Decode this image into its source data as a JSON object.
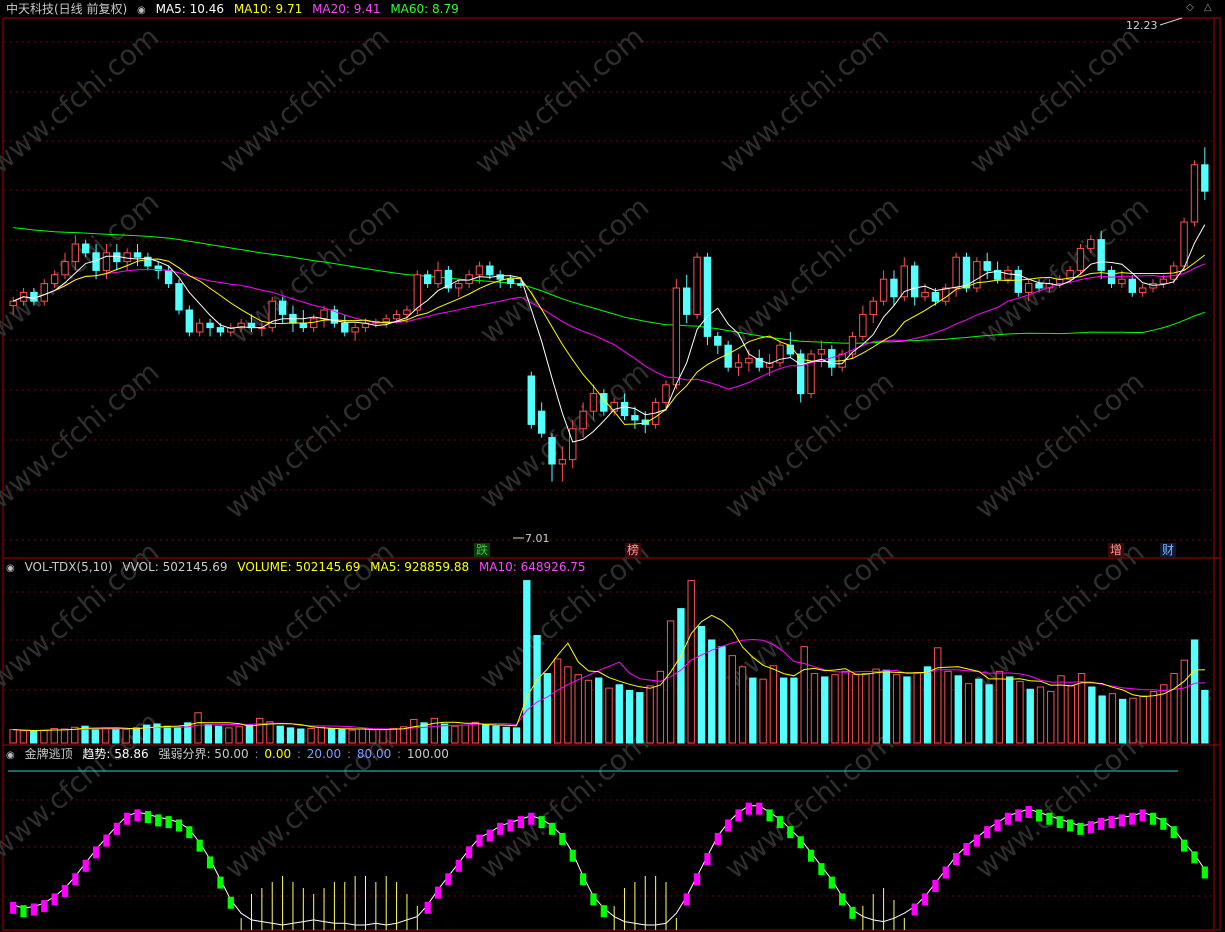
{
  "main_header": {
    "title": "中天科技(日线 前复权)",
    "ma5": "MA5: 10.46",
    "ma10": "MA10: 9.71",
    "ma20": "MA20: 9.41",
    "ma60": "MA60: 8.79"
  },
  "vol_header": {
    "name": "VOL-TDX(5,10)",
    "vvol": "VVOL: 502145.69",
    "volume": "VOLUME: 502145.69",
    "ma5": "MA5: 928859.88",
    "ma10": "MA10: 648926.75"
  },
  "ind_header": {
    "name": "金牌逃顶",
    "trend": "趋势: 58.86",
    "label": "强弱分界: 50.00",
    "v0": "0.00",
    "v20": "20.00",
    "v80": "80.00",
    "v100": "100.00"
  },
  "annotations": {
    "high_label": "12.23",
    "low_label": "7.01"
  },
  "event_tags": [
    {
      "text": "跌",
      "color": "#3cc43c"
    },
    {
      "text": "榜",
      "color": "#ff9999"
    },
    {
      "text": "增",
      "color": "#ff9999"
    },
    {
      "text": "财",
      "color": "#7fb3ff"
    }
  ],
  "watermark": "www.cfchi.com",
  "colors": {
    "up": "#ff5050",
    "down": "#54ffff",
    "ma5": "#ffffff",
    "ma10": "#ffff00",
    "ma20": "#ff00ff",
    "ma60": "#00ff00",
    "frame": "#b00000",
    "grid": "#800000",
    "ind_up": "#ff00ff",
    "ind_down": "#00ff00"
  },
  "chart_data": [
    {
      "type": "candlestick",
      "title": "中天科技(日线 前复权)",
      "ylim": [
        6.5,
        12.5
      ],
      "ohlc": [
        [
          9.3,
          9.4,
          9.2,
          9.35
        ],
        [
          9.35,
          9.5,
          9.3,
          9.45
        ],
        [
          9.45,
          9.5,
          9.3,
          9.35
        ],
        [
          9.35,
          9.6,
          9.3,
          9.55
        ],
        [
          9.55,
          9.7,
          9.5,
          9.65
        ],
        [
          9.65,
          9.9,
          9.6,
          9.8
        ],
        [
          9.8,
          10.1,
          9.7,
          10.0
        ],
        [
          10.0,
          10.05,
          9.85,
          9.9
        ],
        [
          9.9,
          10.0,
          9.6,
          9.7
        ],
        [
          9.7,
          10.0,
          9.6,
          9.9
        ],
        [
          9.9,
          10.0,
          9.7,
          9.8
        ],
        [
          9.8,
          9.95,
          9.7,
          9.9
        ],
        [
          9.9,
          10.0,
          9.75,
          9.85
        ],
        [
          9.85,
          9.9,
          9.7,
          9.75
        ],
        [
          9.75,
          9.8,
          9.6,
          9.7
        ],
        [
          9.7,
          9.75,
          9.5,
          9.55
        ],
        [
          9.55,
          9.6,
          9.2,
          9.25
        ],
        [
          9.25,
          9.3,
          8.95,
          9.0
        ],
        [
          9.0,
          9.15,
          8.95,
          9.1
        ],
        [
          9.1,
          9.15,
          8.95,
          9.05
        ],
        [
          9.05,
          9.1,
          8.95,
          9.0
        ],
        [
          9.0,
          9.1,
          8.95,
          9.05
        ],
        [
          9.05,
          9.15,
          9.0,
          9.1
        ],
        [
          9.1,
          9.2,
          9.0,
          9.05
        ],
        [
          9.05,
          9.1,
          8.95,
          9.05
        ],
        [
          9.05,
          9.4,
          9.0,
          9.35
        ],
        [
          9.35,
          9.4,
          9.1,
          9.2
        ],
        [
          9.2,
          9.3,
          9.0,
          9.1
        ],
        [
          9.1,
          9.25,
          9.0,
          9.05
        ],
        [
          9.05,
          9.2,
          9.0,
          9.15
        ],
        [
          9.15,
          9.3,
          9.05,
          9.25
        ],
        [
          9.25,
          9.3,
          9.05,
          9.1
        ],
        [
          9.1,
          9.2,
          8.95,
          9.0
        ],
        [
          9.0,
          9.1,
          8.9,
          9.05
        ],
        [
          9.05,
          9.15,
          9.0,
          9.1
        ],
        [
          9.1,
          9.15,
          9.05,
          9.12
        ],
        [
          9.12,
          9.2,
          9.05,
          9.15
        ],
        [
          9.15,
          9.25,
          9.1,
          9.2
        ],
        [
          9.2,
          9.3,
          9.1,
          9.25
        ],
        [
          9.25,
          9.7,
          9.2,
          9.65
        ],
        [
          9.65,
          9.7,
          9.5,
          9.55
        ],
        [
          9.55,
          9.8,
          9.5,
          9.7
        ],
        [
          9.7,
          9.75,
          9.45,
          9.5
        ],
        [
          9.5,
          9.6,
          9.4,
          9.55
        ],
        [
          9.55,
          9.7,
          9.5,
          9.65
        ],
        [
          9.65,
          9.8,
          9.55,
          9.75
        ],
        [
          9.75,
          9.8,
          9.6,
          9.65
        ],
        [
          9.65,
          9.7,
          9.5,
          9.6
        ],
        [
          9.6,
          9.65,
          9.5,
          9.55
        ],
        [
          9.55,
          9.6,
          9.5,
          9.53
        ],
        [
          8.5,
          8.55,
          7.9,
          7.95
        ],
        [
          8.1,
          8.2,
          7.8,
          7.85
        ],
        [
          7.8,
          7.85,
          7.3,
          7.5
        ],
        [
          7.5,
          7.7,
          7.3,
          7.55
        ],
        [
          7.55,
          8.0,
          7.45,
          7.9
        ],
        [
          7.9,
          8.2,
          7.8,
          8.1
        ],
        [
          8.1,
          8.4,
          8.0,
          8.3
        ],
        [
          8.3,
          8.35,
          8.05,
          8.1
        ],
        [
          8.1,
          8.25,
          8.05,
          8.2
        ],
        [
          8.2,
          8.3,
          8.0,
          8.05
        ],
        [
          8.05,
          8.15,
          7.9,
          8.0
        ],
        [
          8.0,
          8.1,
          7.85,
          7.95
        ],
        [
          7.95,
          8.25,
          7.9,
          8.2
        ],
        [
          8.2,
          8.45,
          8.1,
          8.4
        ],
        [
          8.4,
          9.6,
          8.35,
          9.5
        ],
        [
          9.5,
          9.65,
          9.1,
          9.2
        ],
        [
          9.2,
          9.9,
          9.15,
          9.85
        ],
        [
          9.85,
          9.9,
          8.85,
          8.95
        ],
        [
          8.95,
          9.0,
          8.75,
          8.85
        ],
        [
          8.85,
          8.9,
          8.55,
          8.6
        ],
        [
          8.6,
          8.75,
          8.5,
          8.65
        ],
        [
          8.65,
          8.8,
          8.55,
          8.7
        ],
        [
          8.7,
          8.8,
          8.55,
          8.6
        ],
        [
          8.6,
          8.75,
          8.5,
          8.65
        ],
        [
          8.65,
          8.9,
          8.6,
          8.85
        ],
        [
          8.85,
          9.0,
          8.7,
          8.75
        ],
        [
          8.75,
          8.8,
          8.2,
          8.3
        ],
        [
          8.3,
          8.8,
          8.25,
          8.75
        ],
        [
          8.75,
          8.9,
          8.6,
          8.8
        ],
        [
          8.8,
          8.85,
          8.5,
          8.6
        ],
        [
          8.6,
          8.8,
          8.55,
          8.75
        ],
        [
          8.75,
          9.0,
          8.7,
          8.95
        ],
        [
          8.95,
          9.3,
          8.9,
          9.2
        ],
        [
          9.2,
          9.4,
          9.1,
          9.35
        ],
        [
          9.35,
          9.7,
          9.3,
          9.6
        ],
        [
          9.6,
          9.7,
          9.3,
          9.4
        ],
        [
          9.4,
          9.85,
          9.35,
          9.75
        ],
        [
          9.75,
          9.8,
          9.3,
          9.4
        ],
        [
          9.4,
          9.55,
          9.35,
          9.45
        ],
        [
          9.45,
          9.5,
          9.3,
          9.35
        ],
        [
          9.35,
          9.55,
          9.3,
          9.5
        ],
        [
          9.5,
          9.9,
          9.4,
          9.85
        ],
        [
          9.85,
          9.9,
          9.45,
          9.5
        ],
        [
          9.5,
          9.85,
          9.45,
          9.8
        ],
        [
          9.8,
          9.9,
          9.6,
          9.7
        ],
        [
          9.7,
          9.8,
          9.55,
          9.6
        ],
        [
          9.6,
          9.75,
          9.55,
          9.7
        ],
        [
          9.7,
          9.75,
          9.4,
          9.45
        ],
        [
          9.45,
          9.6,
          9.35,
          9.55
        ],
        [
          9.55,
          9.6,
          9.45,
          9.5
        ],
        [
          9.5,
          9.6,
          9.45,
          9.55
        ],
        [
          9.55,
          9.65,
          9.5,
          9.6
        ],
        [
          9.6,
          9.75,
          9.55,
          9.7
        ],
        [
          9.7,
          10.0,
          9.65,
          9.95
        ],
        [
          9.95,
          10.1,
          9.9,
          10.05
        ],
        [
          10.05,
          10.15,
          9.6,
          9.7
        ],
        [
          9.7,
          9.75,
          9.5,
          9.55
        ],
        [
          9.55,
          9.7,
          9.5,
          9.6
        ],
        [
          9.6,
          9.65,
          9.4,
          9.45
        ],
        [
          9.45,
          9.55,
          9.4,
          9.5
        ],
        [
          9.5,
          9.6,
          9.45,
          9.55
        ],
        [
          9.55,
          9.65,
          9.5,
          9.6
        ],
        [
          9.6,
          9.8,
          9.55,
          9.75
        ],
        [
          9.75,
          10.3,
          9.7,
          10.25
        ],
        [
          10.25,
          10.95,
          10.2,
          10.9
        ],
        [
          10.9,
          11.1,
          10.5,
          10.6
        ]
      ]
    },
    {
      "type": "bar",
      "title": "VOL-TDX(5,10)",
      "ylim": [
        0,
        1500000
      ],
      "values": [
        120000,
        110000,
        105000,
        115000,
        130000,
        125000,
        140000,
        150000,
        120000,
        135000,
        128000,
        122000,
        135000,
        160000,
        170000,
        150000,
        140000,
        180000,
        270000,
        165000,
        150000,
        135000,
        145000,
        160000,
        220000,
        190000,
        150000,
        135000,
        125000,
        130000,
        140000,
        125000,
        120000,
        115000,
        125000,
        118000,
        122000,
        130000,
        145000,
        210000,
        180000,
        220000,
        170000,
        150000,
        160000,
        185000,
        160000,
        150000,
        140000,
        135000,
        1450000,
        960000,
        620000,
        750000,
        680000,
        610000,
        560000,
        580000,
        490000,
        520000,
        470000,
        450000,
        510000,
        640000,
        1090000,
        1200000,
        1450000,
        1040000,
        920000,
        860000,
        780000,
        680000,
        580000,
        570000,
        690000,
        580000,
        580000,
        860000,
        620000,
        590000,
        610000,
        640000,
        610000,
        620000,
        660000,
        650000,
        610000,
        590000,
        630000,
        680000,
        850000,
        640000,
        600000,
        530000,
        570000,
        520000,
        640000,
        590000,
        550000,
        480000,
        500000,
        460000,
        600000,
        510000,
        620000,
        500000,
        420000,
        440000,
        390000,
        400000,
        420000,
        460000,
        520000,
        620000,
        740000,
        920000,
        470000
      ]
    },
    {
      "type": "bar",
      "title": "金牌逃顶",
      "ylim": [
        0,
        100
      ],
      "values": [
        15,
        13,
        14,
        16,
        20,
        25,
        32,
        40,
        48,
        55,
        62,
        68,
        70,
        69,
        67,
        66,
        64,
        60,
        52,
        42,
        30,
        18,
        10,
        6,
        5,
        4,
        3,
        4,
        5,
        6,
        5,
        4,
        4,
        3,
        3,
        4,
        3,
        4,
        6,
        8,
        15,
        24,
        32,
        40,
        48,
        55,
        58,
        62,
        64,
        66,
        68,
        66,
        62,
        56,
        46,
        32,
        20,
        13,
        8,
        5,
        4,
        3,
        3,
        4,
        10,
        20,
        32,
        44,
        56,
        64,
        70,
        74,
        74,
        70,
        66,
        60,
        54,
        46,
        38,
        30,
        20,
        12,
        8,
        6,
        5,
        7,
        10,
        14,
        20,
        28,
        36,
        44,
        50,
        55,
        60,
        64,
        68,
        70,
        72,
        70,
        68,
        66,
        64,
        62,
        63,
        65,
        66,
        67,
        68,
        70,
        68,
        65,
        60,
        52,
        45,
        36
      ]
    }
  ]
}
